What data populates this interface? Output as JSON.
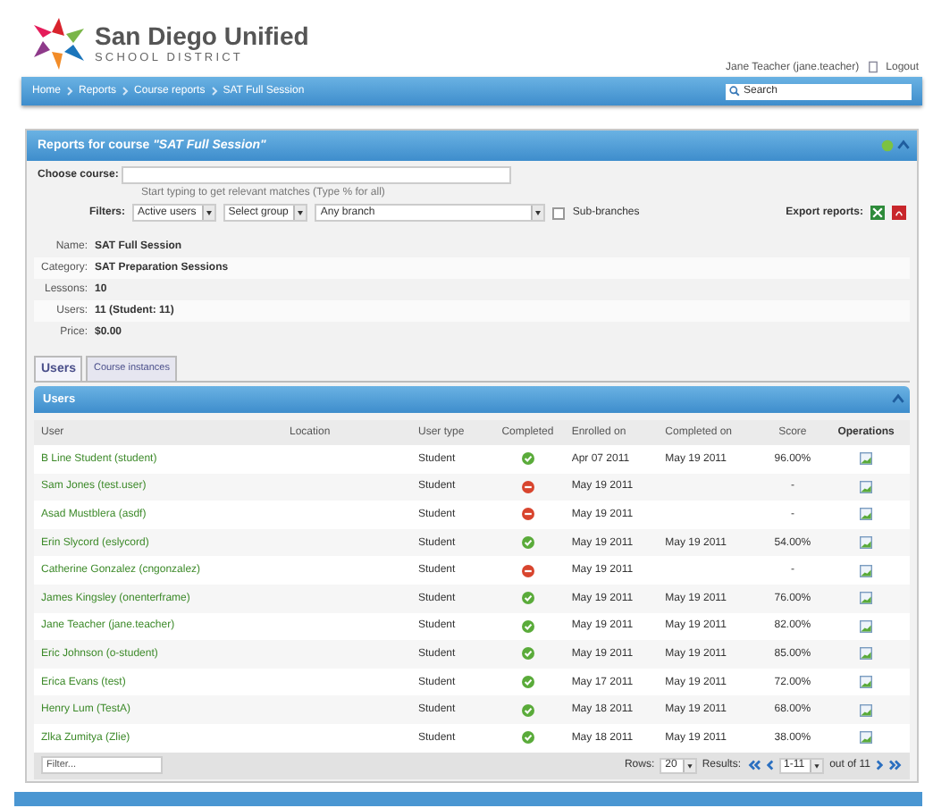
{
  "logo": {
    "name": "San Diego Unified",
    "subtitle": "SCHOOL DISTRICT"
  },
  "user": {
    "name": "Jane Teacher (jane.teacher)",
    "logout": "Logout"
  },
  "breadcrumb": [
    "Home",
    "Reports",
    "Course reports",
    "SAT Full Session"
  ],
  "search": {
    "placeholder": "Search"
  },
  "panel": {
    "title": "Reports for course *\"SAT Full Session\"*",
    "choose_label": "Choose course:",
    "hint": "Start typing to get relevant matches (Type % for all)",
    "filters_label": "Filters:",
    "filters": [
      "Active users",
      "Select group",
      "Any branch"
    ],
    "sub_branches": {
      "label": "Sub-branches",
      "checked": false
    },
    "export_label": "Export reports:"
  },
  "info": [
    {
      "label": "Name:",
      "value": "SAT Full Session"
    },
    {
      "label": "Category:",
      "value": "SAT Preparation Sessions"
    },
    {
      "label": "Lessons:",
      "value": "10"
    },
    {
      "label": "Users:",
      "value": "11 (Student: 11)"
    },
    {
      "label": "Price:",
      "value": "$0.00"
    }
  ],
  "tabs": [
    {
      "label": "Users",
      "selected": true
    },
    {
      "label": "Course instances",
      "selected": false
    }
  ],
  "users": {
    "title": "Users",
    "columns": [
      "User",
      "Location",
      "User type",
      "Completed",
      "Enrolled on",
      "Completed on",
      "Score",
      "Operations"
    ],
    "rows": [
      {
        "user": "B Line Student (student)",
        "type": "Student",
        "completed": true,
        "enrolled": "Apr 07 2011",
        "completed_on": "May 19 2011",
        "score": "96.00%"
      },
      {
        "user": "Sam Jones (test.user)",
        "type": "Student",
        "completed": false,
        "enrolled": "May 19 2011",
        "completed_on": "",
        "score": "-"
      },
      {
        "user": "Asad Mustblera (asdf)",
        "type": "Student",
        "completed": false,
        "enrolled": "May 19 2011",
        "completed_on": "",
        "score": "-"
      },
      {
        "user": "Erin Slycord (eslycord)",
        "type": "Student",
        "completed": true,
        "enrolled": "May 19 2011",
        "completed_on": "May 19 2011",
        "score": "54.00%"
      },
      {
        "user": "Catherine Gonzalez (cngonzalez)",
        "type": "Student",
        "completed": false,
        "enrolled": "May 19 2011",
        "completed_on": "",
        "score": "-"
      },
      {
        "user": "James Kingsley (onenterframe)",
        "type": "Student",
        "completed": true,
        "enrolled": "May 19 2011",
        "completed_on": "May 19 2011",
        "score": "76.00%"
      },
      {
        "user": "Jane Teacher (jane.teacher)",
        "type": "Student",
        "completed": true,
        "enrolled": "May 19 2011",
        "completed_on": "May 19 2011",
        "score": "82.00%"
      },
      {
        "user": "Eric Johnson (o-student)",
        "type": "Student",
        "completed": true,
        "enrolled": "May 19 2011",
        "completed_on": "May 19 2011",
        "score": "85.00%"
      },
      {
        "user": "Erica Evans (test)",
        "type": "Student",
        "completed": true,
        "enrolled": "May 17 2011",
        "completed_on": "May 19 2011",
        "score": "72.00%"
      },
      {
        "user": "Henry Lum (TestA)",
        "type": "Student",
        "completed": true,
        "enrolled": "May 18 2011",
        "completed_on": "May 19 2011",
        "score": "68.00%"
      },
      {
        "user": "Zlka Zumitya (Zlie)",
        "type": "Student",
        "completed": true,
        "enrolled": "May 18 2011",
        "completed_on": "May 19 2011",
        "score": "38.00%"
      }
    ],
    "filter_placeholder": "Filter...",
    "rows_label": "Rows:",
    "rows_value": "20",
    "results_label": "Results:",
    "range": "1-11",
    "out_of": "out of 11"
  }
}
